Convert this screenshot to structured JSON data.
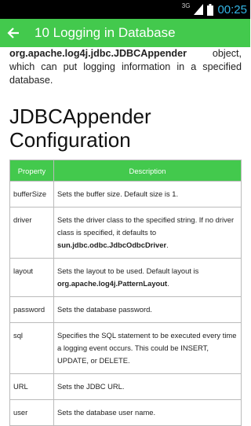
{
  "status": {
    "network": "3G",
    "time": "00:25"
  },
  "app_bar": {
    "title": "10 Logging in Database"
  },
  "intro": {
    "class_name": "org.apache.log4j.jdbc.JDBCAppender",
    "text1": " object, which can put logging information in a specified database."
  },
  "section_title": "JDBCAppender Configuration",
  "table": {
    "headers": [
      "Property",
      "Description"
    ],
    "rows": [
      {
        "prop": "bufferSize",
        "desc1": "Sets the buffer size. Default size is 1.",
        "bold": "",
        "desc2": ""
      },
      {
        "prop": "driver",
        "desc1": "Sets the driver class to the specified string. If no driver class is specified, it defaults to ",
        "bold": "sun.jdbc.odbc.JdbcOdbcDriver",
        "desc2": "."
      },
      {
        "prop": "layout",
        "desc1": "Sets the layout to be used. Default layout is ",
        "bold": "org.apache.log4j.PatternLayout",
        "desc2": "."
      },
      {
        "prop": "password",
        "desc1": "Sets the database password.",
        "bold": "",
        "desc2": ""
      },
      {
        "prop": "sql",
        "desc1": "Specifies the SQL statement to be executed every time a logging event occurs. This could be INSERT, UPDATE, or DELETE.",
        "bold": "",
        "desc2": ""
      },
      {
        "prop": "URL",
        "desc1": "Sets the JDBC URL.",
        "bold": "",
        "desc2": ""
      },
      {
        "prop": "user",
        "desc1": "Sets the database user name.",
        "bold": "",
        "desc2": ""
      }
    ]
  },
  "colors": {
    "accent": "#43c94d",
    "clock": "#33b5e5"
  }
}
